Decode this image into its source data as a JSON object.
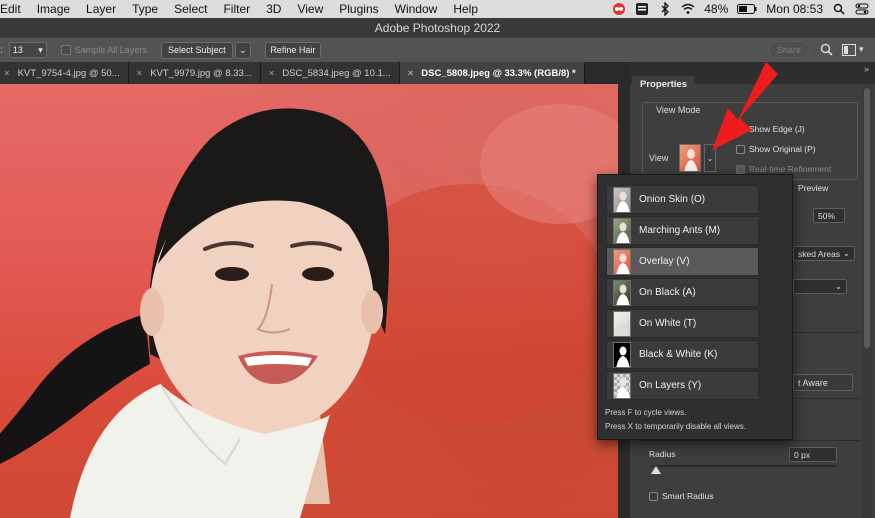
{
  "menubar": {
    "items": [
      "Edit",
      "Image",
      "Layer",
      "Type",
      "Select",
      "Filter",
      "3D",
      "View",
      "Plugins",
      "Window",
      "Help"
    ],
    "battery": "48%",
    "clock": "Mon 08:53"
  },
  "window": {
    "title": "Adobe Photoshop 2022"
  },
  "options": {
    "size_value": "13",
    "sample_all_layers": "Sample All Layers",
    "select_subject": "Select Subject",
    "refine_hair": "Refine Hair",
    "share": "Share"
  },
  "tabs": [
    {
      "label": "KVT_9754-4.jpg @ 50..."
    },
    {
      "label": "KVT_9979.jpg @ 8.33..."
    },
    {
      "label": "DSC_5834.jpeg @ 10.1..."
    },
    {
      "label": "DSC_5808.jpeg @ 33.3% (RGB/8) *"
    }
  ],
  "properties": {
    "tab": "Properties",
    "view_mode_title": "View Mode",
    "view_label": "View",
    "show_edge": "Show Edge (J)",
    "show_original": "Show Original (P)",
    "realtime": "Real-time Refinement",
    "preview": "Preview",
    "opacity_value": "50%",
    "masked_areas": "sked Areas",
    "content_aware": "t Aware",
    "radius_label": "Radius",
    "radius_value": "0 px",
    "smart_radius": "Smart Radius"
  },
  "view_menu": {
    "items": [
      {
        "label": "Onion Skin (O)",
        "thumb": "onion"
      },
      {
        "label": "Marching Ants (M)",
        "thumb": "ants"
      },
      {
        "label": "Overlay (V)",
        "thumb": "overlay"
      },
      {
        "label": "On Black (A)",
        "thumb": "black"
      },
      {
        "label": "On White (T)",
        "thumb": "white"
      },
      {
        "label": "Black & White (K)",
        "thumb": "bw"
      },
      {
        "label": "On Layers (Y)",
        "thumb": "layers"
      }
    ],
    "selected_index": 2,
    "hint1": "Press F to cycle views.",
    "hint2": "Press X to temporarily disable all views."
  },
  "colors": {
    "accent_arrow": "#ee1c1c",
    "overlay_red": "#e05a52"
  }
}
